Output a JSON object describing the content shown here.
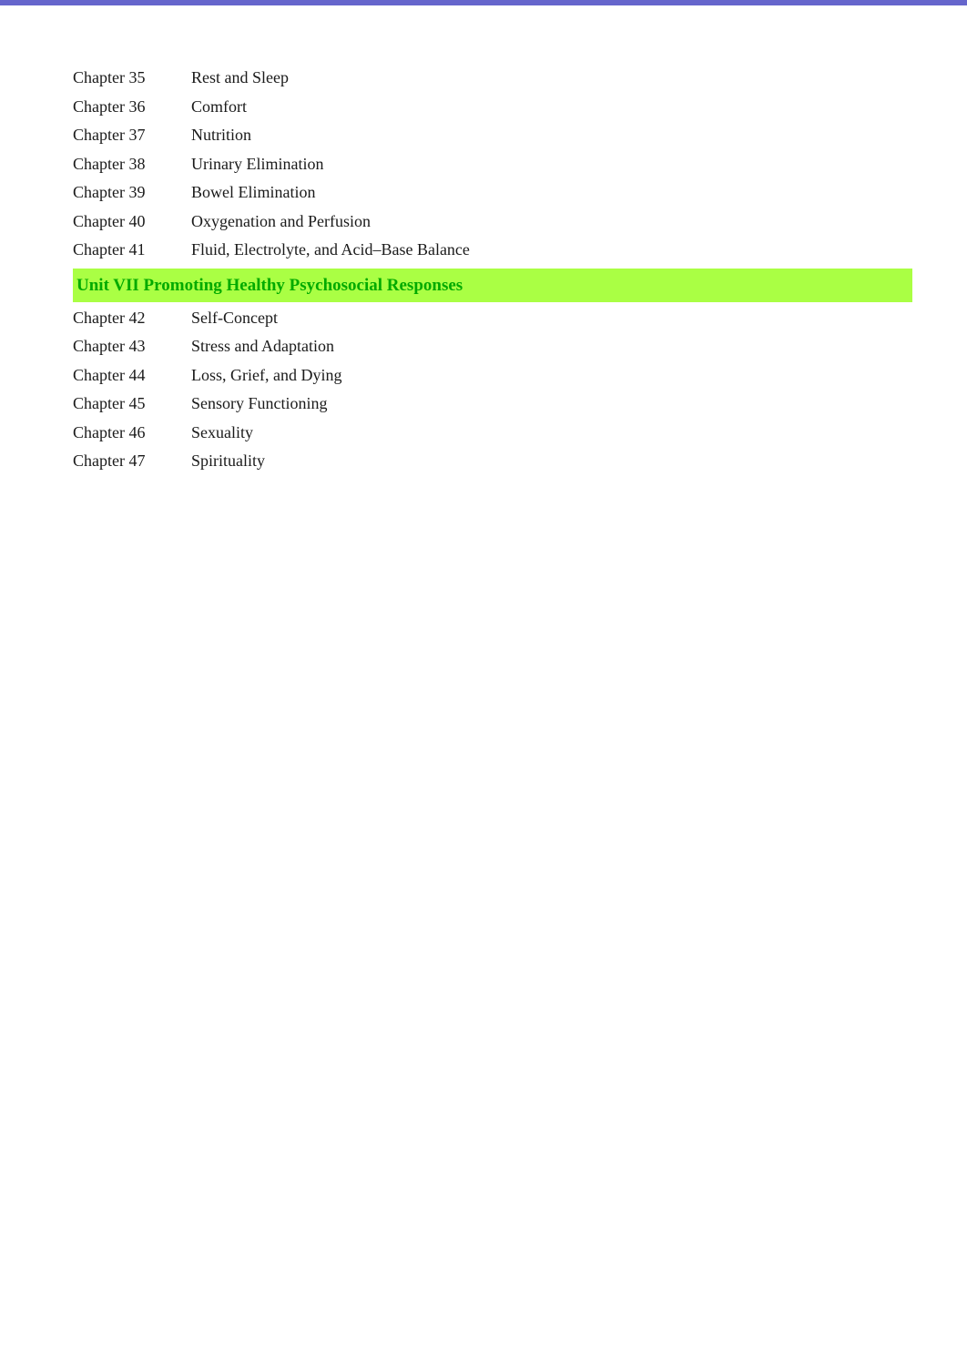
{
  "toc": {
    "chapters": [
      {
        "num": "Chapter 35",
        "title": "Rest and Sleep"
      },
      {
        "num": "Chapter 36",
        "title": "Comfort"
      },
      {
        "num": "Chapter 37",
        "title": "Nutrition"
      },
      {
        "num": "Chapter 38",
        "title": "Urinary Elimination"
      },
      {
        "num": "Chapter 39",
        "title": "Bowel  Elimination"
      },
      {
        "num": "Chapter 40",
        "title": "Oxygenation and Perfusion"
      },
      {
        "num": "Chapter 41",
        "title": "Fluid, Electrolyte, and Acid–Base  Balance"
      }
    ],
    "unit_header": "Unit VII Promoting Healthy Psychosocial Responses",
    "post_unit_chapters": [
      {
        "num": "Chapter 42",
        "title": "Self-Concept"
      },
      {
        "num": "Chapter 43",
        "title": "Stress and Adaptation"
      },
      {
        "num": "Chapter 44",
        "title": "Loss, Grief, and Dying"
      },
      {
        "num": "Chapter 45",
        "title": "Sensory Functioning"
      },
      {
        "num": "Chapter 46",
        "title": "Sexuality"
      },
      {
        "num": "Chapter 47",
        "title": "Spirituality"
      }
    ]
  }
}
